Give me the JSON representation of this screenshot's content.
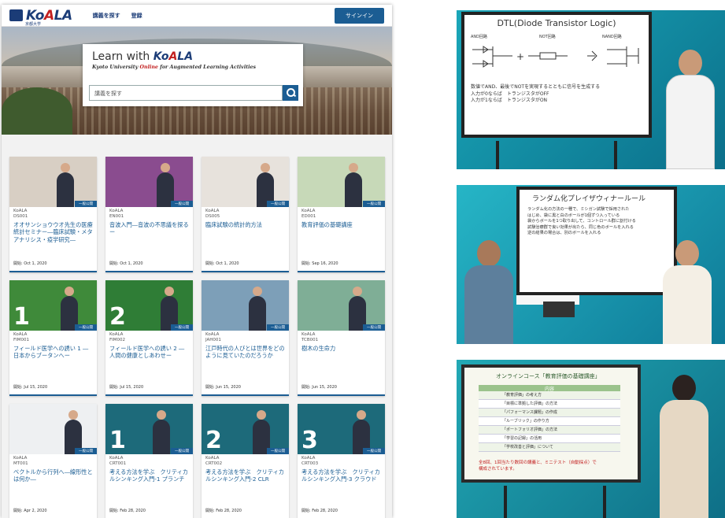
{
  "site": {
    "logo": {
      "brand_a": "Ko",
      "brand_b": "A",
      "brand_c": "LA",
      "sub": "京都大学"
    },
    "nav": {
      "link1": "講義を探す",
      "link2": "登録",
      "signin": "サインイン"
    },
    "hero": {
      "heading_a": "Learn with ",
      "heading_b": "Ko",
      "heading_c": "A",
      "heading_d": "LA",
      "tagline_a": "Kyoto University ",
      "tagline_b": "Online",
      "tagline_c": " for Augmented Learning Activities",
      "search_placeholder": "講義を探す"
    },
    "badge": "一般公開",
    "courses": [
      {
        "org": "KoALA",
        "code": "DS001",
        "title": "オオサンショウウオ先生の医療統計セミナー―臨床試験・メタアナリシス・疫学研究―",
        "date": "開始: Oct 1, 2020",
        "num": ""
      },
      {
        "org": "KoALA",
        "code": "EN001",
        "title": "音波入門―音波の不思議を探るー",
        "date": "開始: Oct 1, 2020",
        "num": ""
      },
      {
        "org": "KoALA",
        "code": "DS005",
        "title": "臨床試験の統計的方法",
        "date": "開始: Oct 1, 2020",
        "num": ""
      },
      {
        "org": "KoALA",
        "code": "ED001",
        "title": "教育評価の基礎講座",
        "date": "開始: Sep 16, 2020",
        "num": ""
      },
      {
        "org": "KoALA",
        "code": "FIM001",
        "title": "フィールド医学への誘い 1 ―日本からブータンへー",
        "date": "開始: Jul 15, 2020",
        "num": "1"
      },
      {
        "org": "KoALA",
        "code": "FIM002",
        "title": "フィールド医学への誘い 2 ―人間の健康としあわせー",
        "date": "開始: Jul 15, 2020",
        "num": "2"
      },
      {
        "org": "KoALA",
        "code": "JAH001",
        "title": "江戸時代の人びとは世界をどのように見ていたのだろうか",
        "date": "開始: Jun 15, 2020",
        "num": ""
      },
      {
        "org": "KoALA",
        "code": "TCB001",
        "title": "樹木の生命力",
        "date": "開始: Jun 15, 2020",
        "num": ""
      },
      {
        "org": "KoALA",
        "code": "MT001",
        "title": "ベクトルから行列へ―線形性とは何か―",
        "date": "開始: Apr 2, 2020",
        "num": ""
      },
      {
        "org": "KoALA",
        "code": "CRT001",
        "title": "考える方法を学ぶ　クリティカルシンキング入門-1 プランチ",
        "date": "開始: Feb 28, 2020",
        "num": "1"
      },
      {
        "org": "KoALA",
        "code": "CRT002",
        "title": "考える方法を学ぶ　クリティカルシンキング入門-2 CLR",
        "date": "開始: Feb 28, 2020",
        "num": "2"
      },
      {
        "org": "KoALA",
        "code": "CRT003",
        "title": "考える方法を学ぶ　クリティカルシンキング入門-3 クラウド",
        "date": "開始: Feb 28, 2020",
        "num": "3"
      }
    ],
    "thumb_colors": [
      "#d8cfc4",
      "#8a4c8f",
      "#e7e2dc",
      "#c7d9b8",
      "#3f8a3a",
      "#2f7d36",
      "#7d9fb8",
      "#7fae96",
      "#eef0f2",
      "#1d6a7a",
      "#1d6a7a",
      "#1d6a7a"
    ]
  },
  "videos": {
    "v1": {
      "title": "DTL(Diode Transistor Logic)",
      "label_and": "AND回路",
      "label_not": "NOT回路",
      "label_nand": "NAND回路",
      "line1": "数値でAND、最後でNOTを実現するとともに信号を生成する",
      "line2": "入力が0ならば　トランジスタがOFF",
      "line3": "入力が1ならば　トランジスタがON"
    },
    "v2": {
      "title": "ランダム化プレイザウィナールール",
      "line1": "ランダム化の方法の一種で、ミシガン試験で採用された",
      "line2": "はじめ、袋に黒と白のボールが1個ずつ入っている",
      "line3": "袋からボールを1つ取り出して、コントロール群に割付ける",
      "line4": "試験治療群で良い効果が出たら、同じ色のボールを入れる",
      "line5": "逆の結果の場合は、別のボールを入れる"
    },
    "v3": {
      "title": "オンラインコース「教育評価の基礎講座」",
      "header": "内容",
      "rows": [
        "「教育評価」の考え方",
        "「目標に準拠した評価」の方法",
        "「パフォーマンス課題」の作成",
        "「ルーブリック」の作り方",
        "「ポートフォリオ評価」の方法",
        "「学習の記録」の活用",
        "「学校改善と評価」について"
      ],
      "note1": "全8回、1回当たり数回の講義と、ミニテスト（自動採点）で",
      "note2": "構成されています。"
    }
  }
}
